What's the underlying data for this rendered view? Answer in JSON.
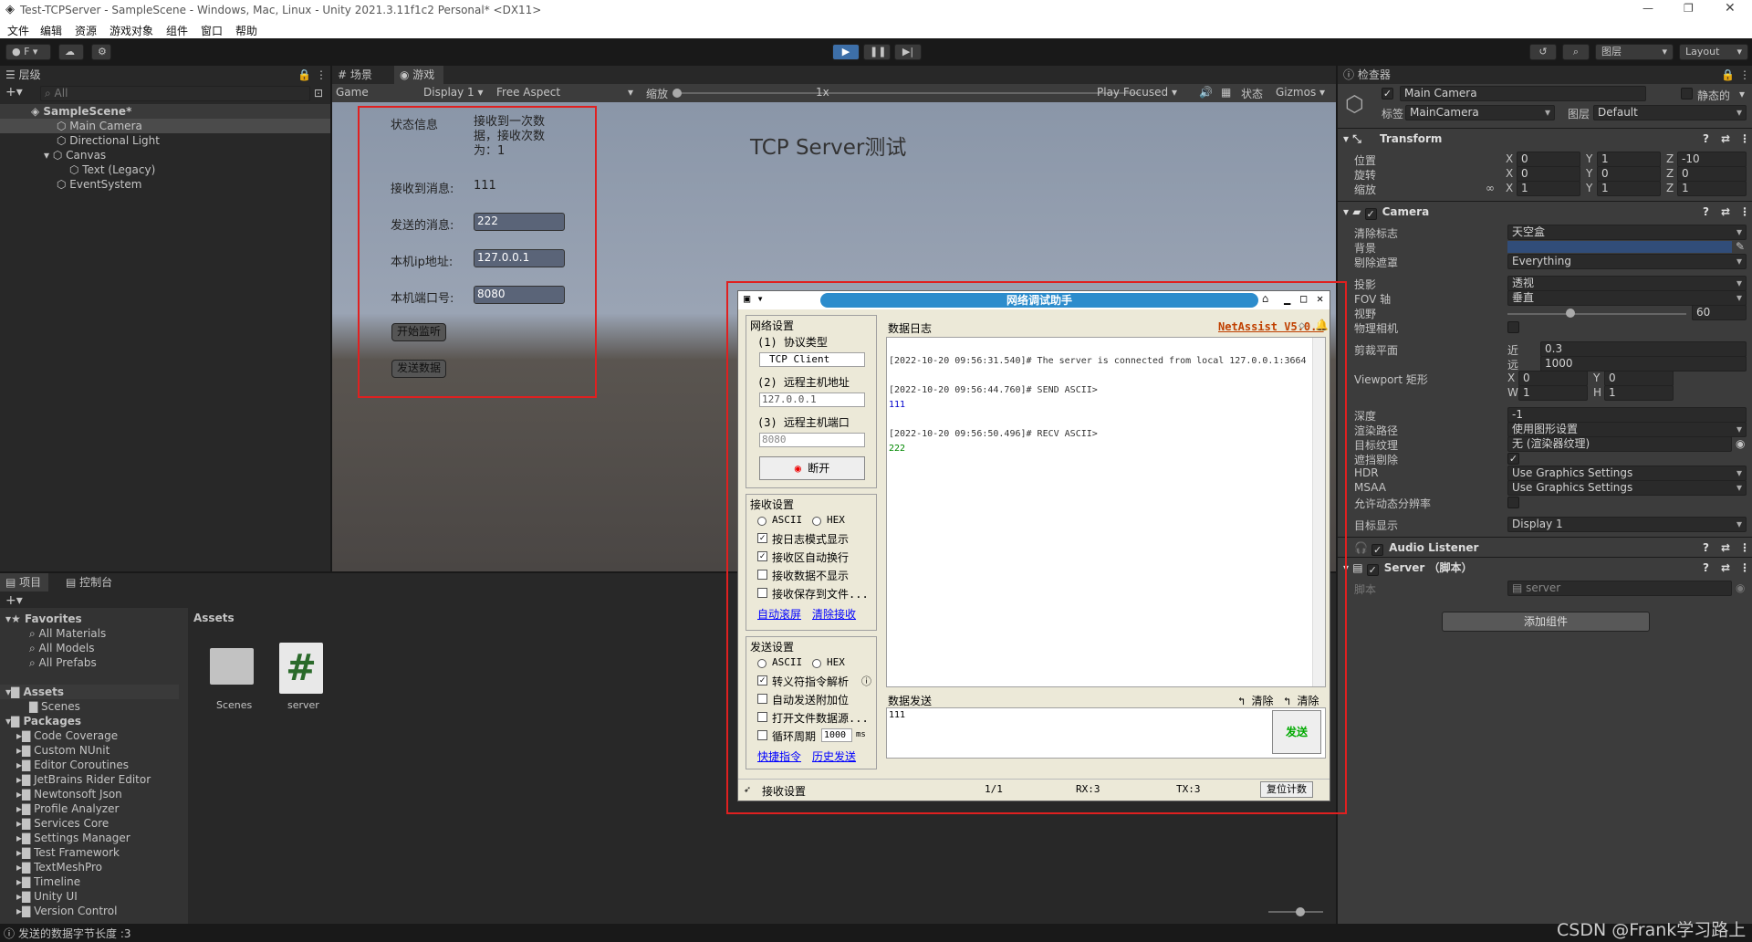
{
  "title": "Test-TCPServer - SampleScene - Windows, Mac, Linux - Unity 2021.3.11f1c2 Personal* <DX11>",
  "menu": [
    "文件",
    "编辑",
    "资源",
    "游戏对象",
    "组件",
    "窗口",
    "帮助"
  ],
  "toolbar": {
    "account": "F",
    "layers": "图层",
    "layout": "Layout"
  },
  "hierarchy": {
    "tab": "层级",
    "search": "All",
    "items": [
      "SampleScene*",
      "Main Camera",
      "Directional Light",
      "Canvas",
      "Text (Legacy)",
      "EventSystem"
    ]
  },
  "scene_tabs": {
    "scene": "场景",
    "game": "游戏"
  },
  "game_bar": {
    "mode": "Game",
    "display": "Display 1",
    "aspect": "Free Aspect",
    "scale_label": "缩放",
    "scale": "1x",
    "play_focused": "Play Focused",
    "stats": "状态",
    "gizmos": "Gizmos"
  },
  "game_ui": {
    "status_label": "状态信息",
    "status_value": "接收到一次数据，接收次数为：1",
    "recv_label": "接收到消息:",
    "recv_value": "111",
    "send_label": "发送的消息:",
    "send_value": "222",
    "ip_label": "本机ip地址:",
    "ip_value": "127.0.0.1",
    "port_label": "本机端口号:",
    "port_value": "8080",
    "start_btn": "开始监听",
    "send_btn": "发送数据",
    "heading": "TCP Server测试"
  },
  "netassist": {
    "title": "网络调试助手",
    "brand": "NetAssist V5.0.3",
    "net_settings": "网络设置",
    "proto_label": "(1) 协议类型",
    "proto": "TCP Client",
    "host_label": "(2) 远程主机地址",
    "host": "127.0.0.1",
    "port_label": "(3) 远程主机端口",
    "port": "8080",
    "disconnect": "断开",
    "recv_settings": "接收设置",
    "ascii": "ASCII",
    "hex": "HEX",
    "recv_opts": [
      "按日志模式显示",
      "接收区自动换行",
      "接收数据不显示",
      "接收保存到文件..."
    ],
    "auto_scroll": "自动滚屏",
    "clear_recv": "清除接收",
    "send_settings": "发送设置",
    "send_opts": [
      "转义符指令解析",
      "自动发送附加位",
      "打开文件数据源...",
      "循环周期"
    ],
    "cycle": "1000",
    "ms": "ms",
    "shortcut": "快捷指令",
    "history": "历史发送",
    "log_tab": "数据日志",
    "log": [
      {
        "t": "[2022-10-20 09:56:31.540]# The server is connected from local 127.0.0.1:3664",
        "c": "#333"
      },
      {
        "t": "[2022-10-20 09:56:44.760]# SEND ASCII>",
        "c": "#333"
      },
      {
        "t": "111",
        "c": "#00c"
      },
      {
        "t": "[2022-10-20 09:56:50.496]# RECV ASCII>",
        "c": "#333"
      },
      {
        "t": "222",
        "c": "#080"
      }
    ],
    "send_tab": "数据发送",
    "clear1": "清除",
    "clear2": "清除",
    "send_text": "111",
    "send_btn": "发送",
    "status": "接收设置",
    "page": "1/1",
    "rx": "RX:3",
    "tx": "TX:3",
    "reset": "复位计数"
  },
  "inspector": {
    "tab": "检查器",
    "name": "Main Camera",
    "static": "静态的",
    "tag_label": "标签",
    "tag": "MainCamera",
    "layer_label": "图层",
    "layer": "Default",
    "transform": "Transform",
    "pos": "位置",
    "rot": "旋转",
    "scale": "缩放",
    "pos_v": [
      "0",
      "1",
      "-10"
    ],
    "rot_v": [
      "0",
      "0",
      "0"
    ],
    "scale_v": [
      "1",
      "1",
      "1"
    ],
    "camera": "Camera",
    "rows": [
      [
        "清除标志",
        "天空盒"
      ],
      [
        "背景",
        ""
      ],
      [
        "剔除遮罩",
        "Everything"
      ],
      [
        "投影",
        "透视"
      ],
      [
        "FOV 轴",
        "垂直"
      ],
      [
        "视野",
        "60"
      ],
      [
        "物理相机",
        ""
      ],
      [
        "剪裁平面",
        ""
      ],
      [
        "",
        ""
      ],
      [
        "Viewport 矩形",
        ""
      ],
      [
        "",
        ""
      ],
      [
        "深度",
        "-1"
      ],
      [
        "渲染路径",
        "使用图形设置"
      ],
      [
        "目标纹理",
        "无 (渲染器纹理)"
      ],
      [
        "遮挡剔除",
        ""
      ],
      [
        "HDR",
        "Use Graphics Settings"
      ],
      [
        "MSAA",
        "Use Graphics Settings"
      ],
      [
        "允许动态分辨率",
        ""
      ],
      [
        "目标显示",
        "Display 1"
      ]
    ],
    "near_label": "近",
    "near": "0.3",
    "far_label": "远",
    "far": "1000",
    "vx": "0",
    "vy": "0",
    "vw": "1",
    "vh": "1",
    "audio": "Audio Listener",
    "server": "Server （脚本）",
    "script_label": "脚本",
    "script": "server",
    "add": "添加组件"
  },
  "project": {
    "tab1": "项目",
    "tab2": "控制台",
    "fav": "Favorites",
    "favs": [
      "All Materials",
      "All Models",
      "All Prefabs"
    ],
    "assets": "Assets",
    "scenes": "Scenes",
    "packages": "Packages",
    "pkgs": [
      "Code Coverage",
      "Custom NUnit",
      "Editor Coroutines",
      "JetBrains Rider Editor",
      "Newtonsoft Json",
      "Profile Analyzer",
      "Services Core",
      "Settings Manager",
      "Test Framework",
      "TextMeshPro",
      "Timeline",
      "Unity UI",
      "Version Control"
    ],
    "path": "Assets",
    "file1": "Scenes",
    "file2": "server"
  },
  "statusbar": "发送的数据字节长度 :3",
  "watermark": "CSDN @Frank学习路上"
}
